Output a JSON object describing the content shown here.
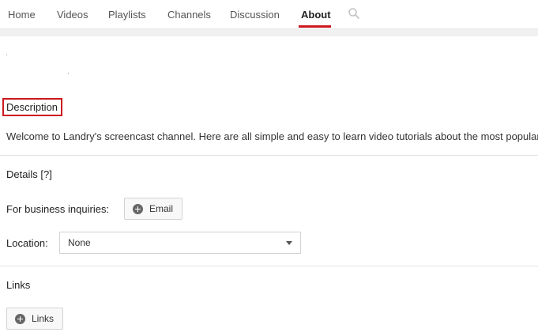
{
  "tabs": [
    {
      "label": "Home"
    },
    {
      "label": "Videos"
    },
    {
      "label": "Playlists"
    },
    {
      "label": "Channels"
    },
    {
      "label": "Discussion"
    },
    {
      "label": "About",
      "active": true
    }
  ],
  "description": {
    "heading": "Description",
    "text": "Welcome to Landry's screencast channel. Here are all simple and easy to learn video tutorials about the most popular"
  },
  "details": {
    "heading": "Details [?]",
    "business_label": "For business inquiries:",
    "email_button": "Email",
    "location_label": "Location:",
    "location_value": "None"
  },
  "links": {
    "heading": "Links",
    "button": "Links"
  },
  "colors": {
    "accent": "#cc181e",
    "band": "#f1f1f1"
  },
  "icons": {
    "search": "search-icon",
    "add": "plus-circle-icon",
    "dropdown": "caret-down-icon"
  }
}
